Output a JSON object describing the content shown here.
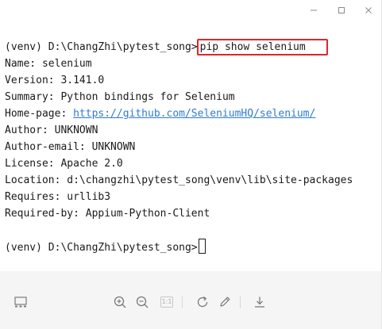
{
  "terminal": {
    "lines": [
      {
        "prompt": "(venv) D:\\ChangZhi\\pytest_song>",
        "command": "pip show selenium"
      },
      {
        "label": "Name: ",
        "value": "selenium"
      },
      {
        "label": "Version: ",
        "value": "3.141.0"
      },
      {
        "label": "Summary: ",
        "value": "Python bindings for Selenium"
      },
      {
        "label": "Home-page: ",
        "value": "https://github.com/SeleniumHQ/selenium/"
      },
      {
        "label": "Author: ",
        "value": "UNKNOWN"
      },
      {
        "label": "Author-email: ",
        "value": "UNKNOWN"
      },
      {
        "label": "License: ",
        "value": "Apache 2.0"
      },
      {
        "label": "Location: ",
        "value": "d:\\changzhi\\pytest_song\\venv\\lib\\site-packages"
      },
      {
        "label": "Requires: ",
        "value": "urllib3"
      },
      {
        "label": "Required-by: ",
        "value": "Appium-Python-Client"
      },
      {
        "prompt": "(venv) D:\\ChangZhi\\pytest_song>",
        "command": ""
      }
    ]
  },
  "toolbar": {
    "page_indicator": "1:1"
  },
  "colors": {
    "highlight_box": "#e0262a",
    "link": "#2f7bd6",
    "text": "#1a1a1a",
    "toolbar_bg": "#f5f5f5",
    "icon": "#7a7a7a"
  },
  "icons": {
    "window_controls": [
      "minimize-icon",
      "maximize-icon",
      "close-icon"
    ],
    "toolbar": [
      "layout-icon",
      "zoom-in-icon",
      "zoom-out-icon",
      "actual-size-icon",
      "rotate-icon",
      "edit-icon",
      "download-icon"
    ]
  }
}
